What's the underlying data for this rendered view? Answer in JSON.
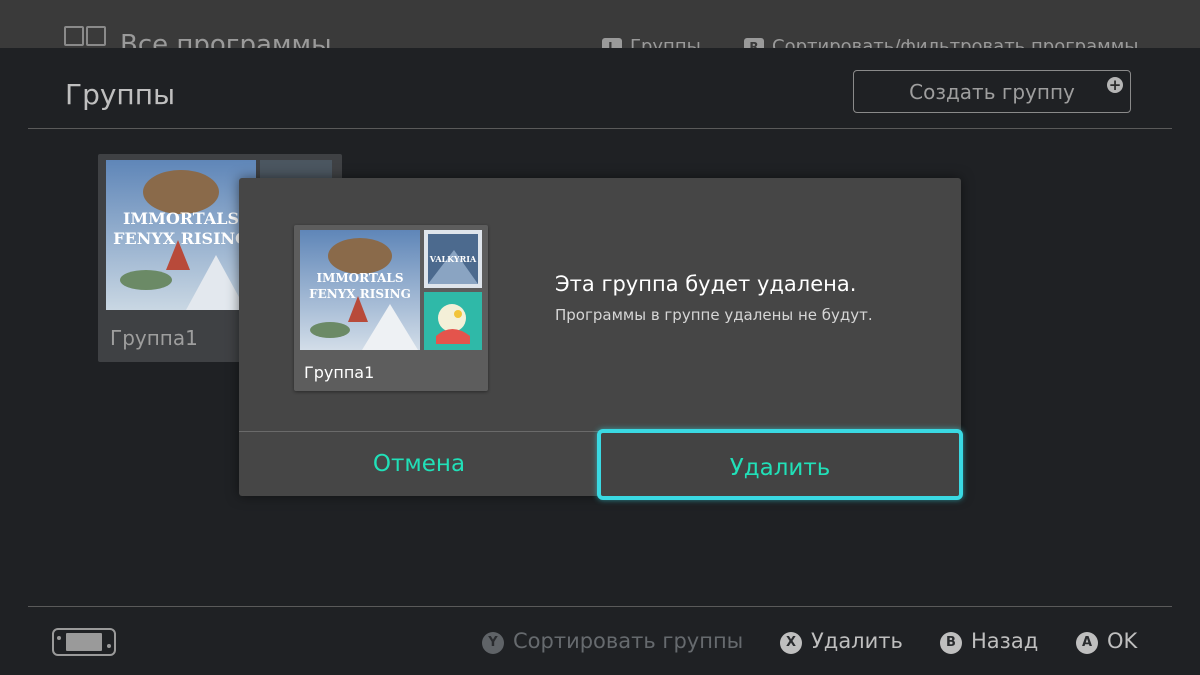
{
  "top_bar": {
    "title": "Все программы",
    "hint_groups_button": "L",
    "hint_groups": "Группы",
    "hint_sort_button": "R",
    "hint_sort": "Сортировать/фильтровать программы"
  },
  "page": {
    "title": "Группы",
    "create_group_label": "Создать группу",
    "plus_symbol": "+"
  },
  "group_card": {
    "label": "Группа1",
    "art_text_line1": "IMMORTALS",
    "art_text_line2": "FENYX RISING",
    "art_side_text": "VALKYRIA"
  },
  "dialog": {
    "title": "Эта группа будет удалена.",
    "subtitle": "Программы в группе удалены не будут.",
    "cancel_label": "Отмена",
    "delete_label": "Удалить"
  },
  "footer": {
    "hints": [
      {
        "button": "Y",
        "label": "Сортировать группы",
        "enabled": false
      },
      {
        "button": "X",
        "label": "Удалить",
        "enabled": true
      },
      {
        "button": "B",
        "label": "Назад",
        "enabled": true
      },
      {
        "button": "A",
        "label": "OK",
        "enabled": true
      }
    ]
  },
  "colors": {
    "accent_text": "#21e0b8",
    "focus_border": "#3ad9e3",
    "dialog_bg": "#464646"
  }
}
